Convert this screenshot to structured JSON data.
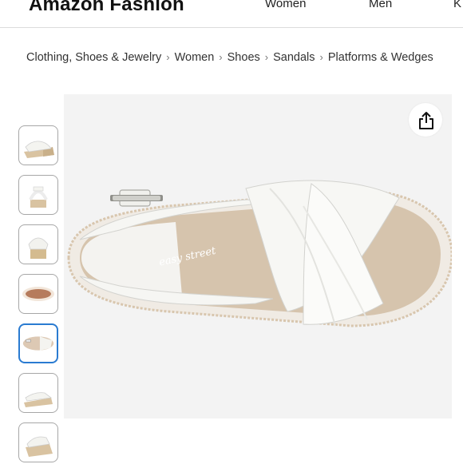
{
  "header": {
    "brand": "Amazon Fashion",
    "nav": [
      "Women",
      "Men",
      "K"
    ]
  },
  "breadcrumb": [
    "Clothing, Shoes & Jewelry",
    "Women",
    "Shoes",
    "Sandals",
    "Platforms & Wedges"
  ],
  "breadcrumb_separator": "›",
  "product": {
    "thumbnails": [
      {
        "view": "side-left"
      },
      {
        "view": "back"
      },
      {
        "view": "front"
      },
      {
        "view": "sole"
      },
      {
        "view": "top",
        "selected": true
      },
      {
        "view": "side-right"
      },
      {
        "view": "angle"
      }
    ],
    "insole_print": "easy street"
  },
  "icons": {
    "share": "share-icon"
  },
  "colors": {
    "selected_thumb": "#2a7bd1",
    "image_bg": "#f3f3f3"
  }
}
